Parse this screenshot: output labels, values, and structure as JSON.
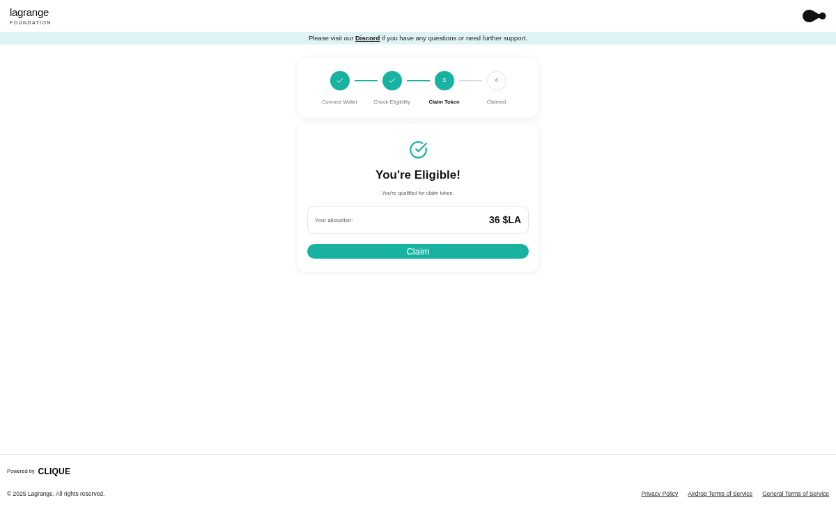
{
  "header": {
    "logo_name": "lagrange",
    "logo_subtitle": "FOUNDATION"
  },
  "banner": {
    "before": "Please visit our",
    "link": "Discord",
    "after": "if you have any questions or need further support."
  },
  "steps": [
    {
      "label": "Connect Wallet",
      "kind": "done"
    },
    {
      "label": "Check Eligibility",
      "kind": "done"
    },
    {
      "number": "3",
      "label": "Claim Token",
      "kind": "current"
    },
    {
      "number": "4",
      "label": "Claimed",
      "kind": "upcoming"
    }
  ],
  "eligibility": {
    "title": "You're Eligible!",
    "message": "You're qualified for claim token.",
    "allocation_label": "Your allocation:",
    "allocation_value": "36 $LA",
    "button": "Claim"
  },
  "footer": {
    "powered_by": "Powered by",
    "brand": "CLIQUE",
    "copyright": "© 2025 Lagrange. All rights reserved.",
    "links": [
      "Privacy Policy",
      "Airdrop Terms of Service",
      "General Terms of Service"
    ]
  }
}
